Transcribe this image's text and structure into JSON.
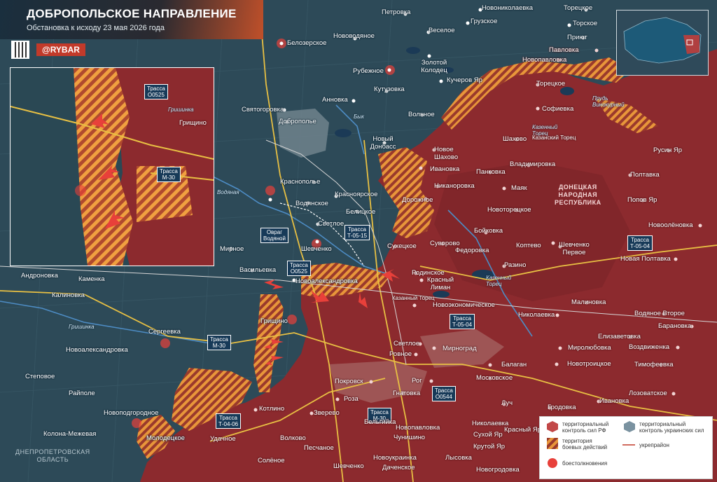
{
  "header": {
    "title": "ДОБРОПОЛЬСКОЕ НАПРАВЛЕНИЕ",
    "subtitle": "Обстановка к исходу 23 мая 2026 года",
    "brand": "@RYBAR"
  },
  "places_blue": [
    "Новониколаевка",
    "Торецкое",
    "Петровка",
    "Грузское",
    "Торское",
    "Веселое",
    "Приют",
    "Белозерское",
    "Нововодяное",
    "Золотой Колодец",
    "Рубежное",
    "Кучеров Яр",
    "Кутузовка",
    "Анновка",
    "Святогоровка",
    "Доброполье",
    "Вольное",
    "Новый Донбасс",
    "Краснополье",
    "Водянское",
    "Красноярское",
    "Белицкое",
    "Светлое",
    "Шевченко",
    "Мирное",
    "Васильевка",
    "Новоалександровка",
    "Андроновка",
    "Каменка",
    "Калиновка",
    "Сергеевка",
    "Новоалександровка",
    "Степовое",
    "Райполе",
    "Новоподгородное",
    "Колона-Межевая",
    "Молодецкое",
    "Грищино"
  ],
  "places_red": [
    "Павловка",
    "Новопавловка",
    "Торецкое",
    "Софиевка",
    "Шахово",
    "Новое Шахово",
    "Русин Яр",
    "Ивановка",
    "Владимировка",
    "Панковка",
    "Полтавка",
    "Никаноровка",
    "Маяк",
    "Дорожное",
    "Попов Яр",
    "Новоторецкое",
    "Сухецкое",
    "Суворово",
    "Бойковка",
    "Федоровка",
    "Коптево",
    "Шевченко Первое",
    "Новоолёновка",
    "Родинское",
    "Красный Лиман",
    "Разино",
    "Новая Полтавка",
    "Малиновка",
    "Новоэкономическое",
    "Николаевка",
    "Водяное Второе",
    "Барановка",
    "Светлое",
    "Ровное",
    "Мирноград",
    "Елизаветовка",
    "Миролюбовка",
    "Воздвиженка",
    "Балаган",
    "Новотроицкое",
    "Тимофеевка",
    "Покровск",
    "Рог",
    "Московское",
    "Лозоватское",
    "Роза",
    "Гнатовка",
    "Луч",
    "Гродовка",
    "Ивановка",
    "Котлино",
    "Зверево",
    "Бельгийка",
    "Новопавловка",
    "Николаевка",
    "Чунишино",
    "Сухой Яр",
    "Крутой Яр",
    "Удачное",
    "Волково",
    "Песчаное",
    "Новоукраинка",
    "Лысовка",
    "Солёное",
    "Шевченко",
    "Даченское",
    "Новогродовка",
    "Казанский Торец",
    "Казанный Торец",
    "Красный Яр"
  ],
  "regions": {
    "dnr": "ДОНЕЦКАЯ\nНАРОДНАЯ\nРЕСПУБЛИКА",
    "dnepr": "ДНЕПРОПЕТРОВСКАЯ\nОБЛАСТЬ"
  },
  "rivers": [
    "Бык",
    "Водяная",
    "Казенный\nТорец",
    "Казенный\nТорец",
    "Прудь\nВинокурный",
    "Гришинка",
    "Гришинка"
  ],
  "gully": "Овраг\nВодяной",
  "highways": [
    "Трасса\nО0525",
    "Трасса\nМ-30",
    "Трасса\nТ-05-15",
    "Трасса\nО0525",
    "Трасса\nМ-30",
    "Трасса\nТ-05-04",
    "Трасса\nТ-05-04",
    "Трасса\nО0544",
    "Трасса\nМ-30",
    "Трасса\nТ-04-06"
  ],
  "legend": {
    "ru_control": "территориальный\nконтроль сил РФ",
    "ua_control": "территориальный\nконтроль украинских сил",
    "combat": "территория\nбоевых действий",
    "fortified": "укрепрайон",
    "clashes": "боестолкновения"
  },
  "colors": {
    "water": "#1e3c4c",
    "ua_land": "#2c4a5a",
    "ru_land": "#8c2a2e",
    "combat_hatch": "#e89638",
    "accent": "#e8403a"
  }
}
